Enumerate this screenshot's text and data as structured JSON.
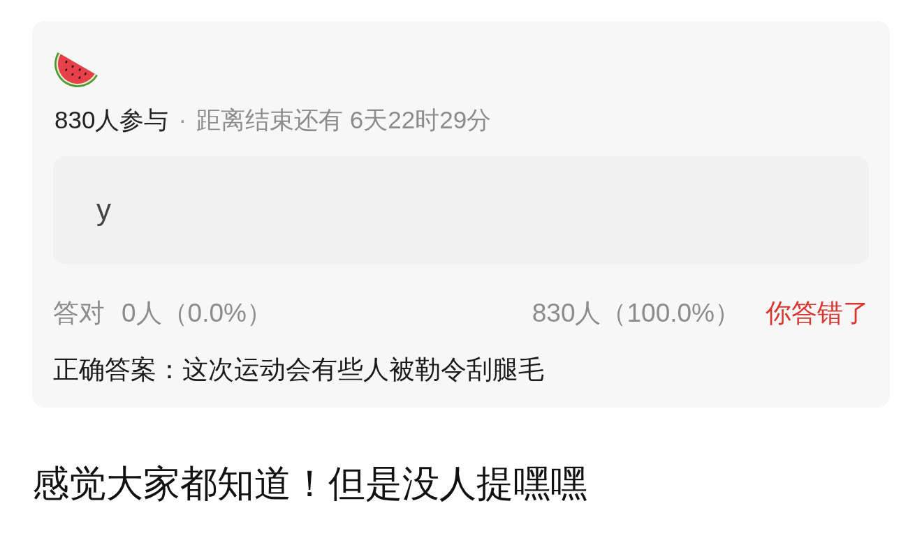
{
  "quiz_card": {
    "participants": "830人参与",
    "separator": "·",
    "countdown": "距离结束还有 6天22时29分",
    "option": {
      "text": "y"
    },
    "stats": {
      "correct_label": "答对",
      "correct_count": "0人（0.0%）",
      "option_count": "830人（100.0%）",
      "result": {
        "text": "你答错了",
        "correct": false
      }
    },
    "correct_answer": {
      "label": "正确答案：",
      "text": "这次运动会有些人被勒令刮腿毛"
    }
  },
  "post_text": "感觉大家都知道！但是没人提嘿嘿"
}
